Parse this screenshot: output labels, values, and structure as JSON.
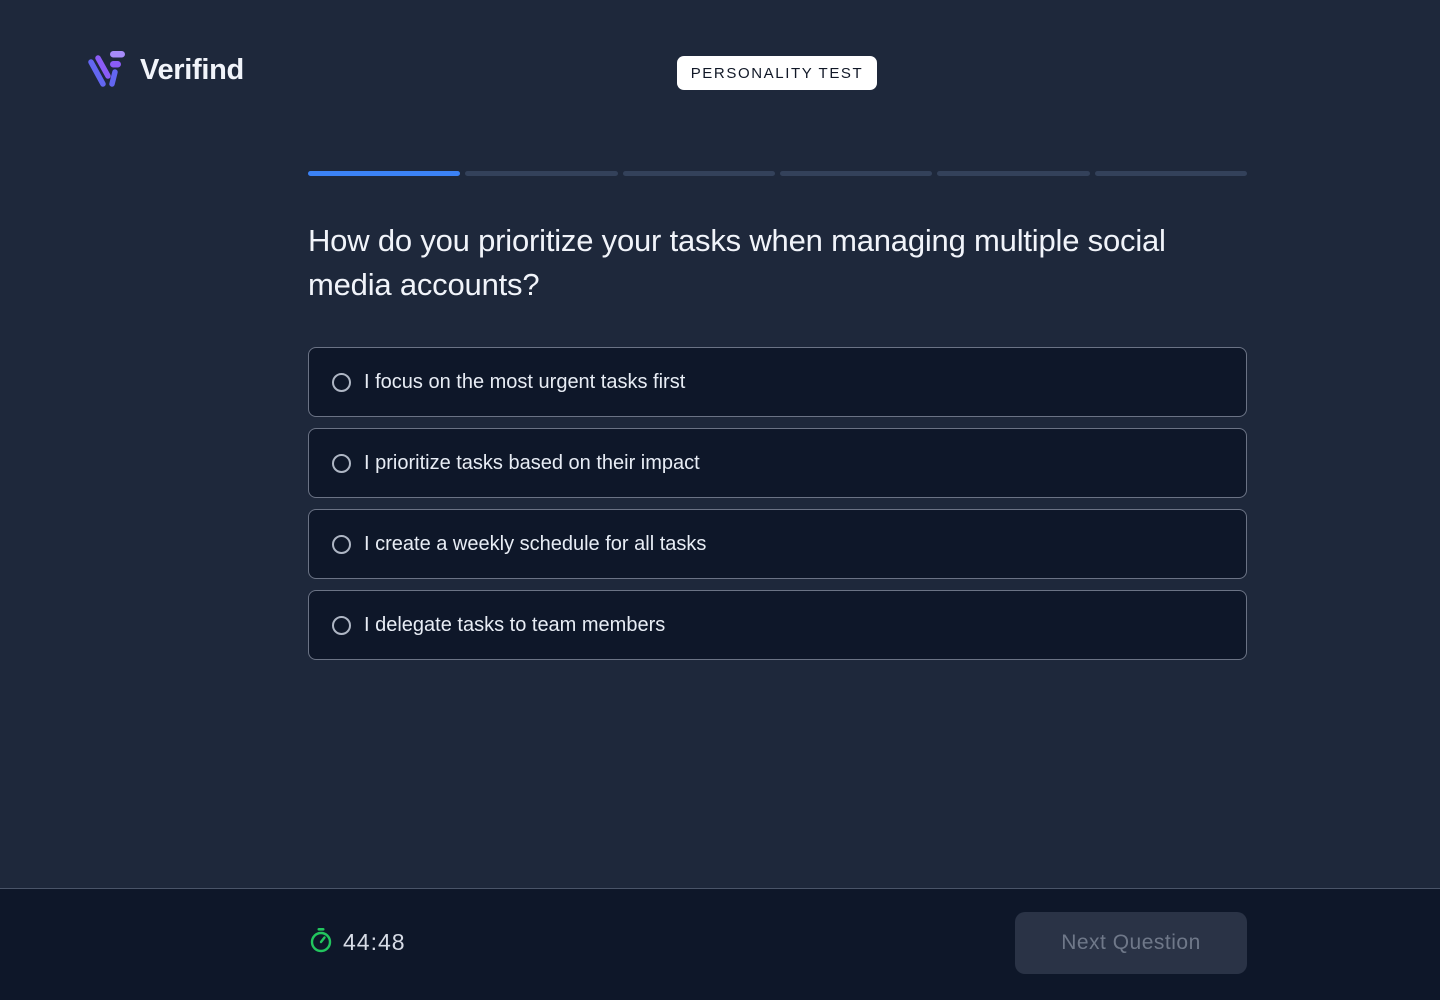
{
  "brand": {
    "name": "Verifind",
    "logo_icon": "verifind-logo-icon",
    "logo_colors": [
      "#6366f1",
      "#8b5cf6",
      "#a78bfa"
    ]
  },
  "badge": {
    "label": "PERSONALITY TEST"
  },
  "progress": {
    "total_steps": 6,
    "current_step": 1,
    "active_color": "#3b82f6",
    "inactive_color": "#33415a"
  },
  "question": {
    "text": "How do you prioritize your tasks when managing multiple social media accounts?"
  },
  "options": [
    {
      "label": "I focus on the most urgent tasks first",
      "selected": false
    },
    {
      "label": "I prioritize tasks based on their impact",
      "selected": false
    },
    {
      "label": "I create a weekly schedule for all tasks",
      "selected": false
    },
    {
      "label": "I delegate tasks to team members",
      "selected": false
    }
  ],
  "footer": {
    "timer": "44:48",
    "timer_icon": "stopwatch-icon",
    "timer_icon_color": "#22c55e",
    "next_label": "Next Question",
    "next_disabled": true
  },
  "colors": {
    "background": "#1e283b",
    "footer_background": "#0e1729",
    "option_background": "#0e1729"
  }
}
